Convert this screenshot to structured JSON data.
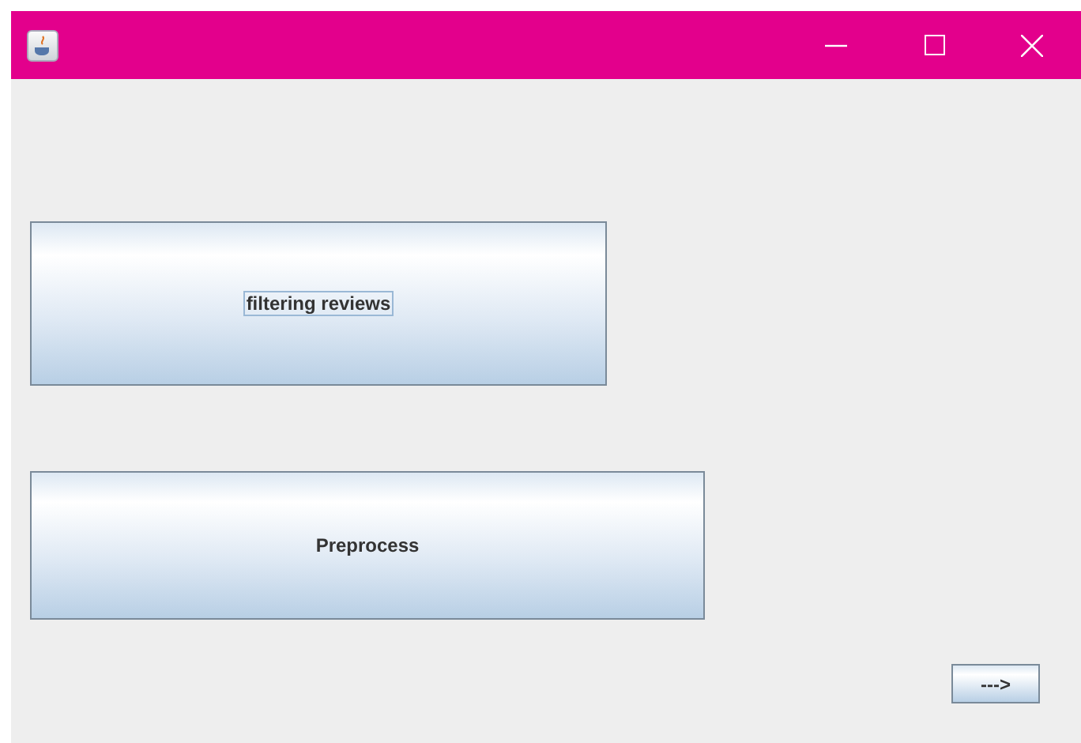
{
  "window": {
    "title_controls": [
      {
        "kind": "minimize"
      },
      {
        "kind": "maximize"
      },
      {
        "kind": "close"
      }
    ]
  },
  "buttons": [
    {
      "label": "filtering reviews",
      "focused": true
    },
    {
      "label": "Preprocess",
      "focused": false
    }
  ],
  "next_button": {
    "label": "--->"
  }
}
